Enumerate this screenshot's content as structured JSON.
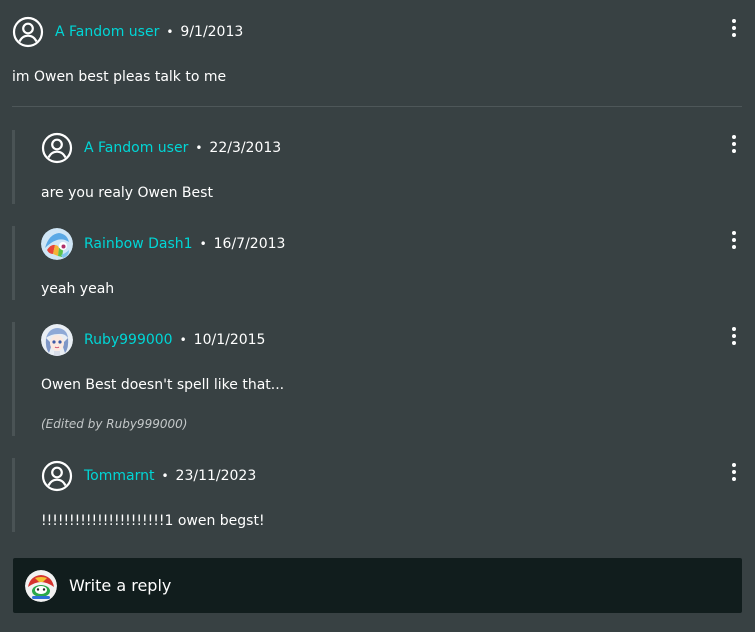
{
  "thread": {
    "root": {
      "user": "A Fandom user",
      "date": "9/1/2013",
      "text": "im Owen best pleas talk to me",
      "avatar_icon": "default-user-icon"
    },
    "replies": [
      {
        "user": "A Fandom user",
        "date": "22/3/2013",
        "text": "are you realy Owen Best",
        "avatar_icon": "default-user-icon"
      },
      {
        "user": "Rainbow Dash1",
        "date": "16/7/2013",
        "text": "yeah yeah",
        "avatar_icon": "rainbow-dash-avatar"
      },
      {
        "user": "Ruby999000",
        "date": "10/1/2015",
        "text": "Owen Best doesn't spell like that...",
        "edited_note": "(Edited by Ruby999000)",
        "avatar_icon": "ruby-avatar"
      },
      {
        "user": "Tommarnt",
        "date": "23/11/2023",
        "text": "!!!!!!!!!!!!!!!!!!!!!!1 owen begst!",
        "avatar_icon": "default-user-icon"
      }
    ]
  },
  "separator": "•",
  "reply_box": {
    "placeholder": "Write a reply",
    "avatar_icon": "current-user-avatar"
  },
  "colors": {
    "background": "#384143",
    "username": "#00d6d6",
    "reply_box": "#111d1d",
    "rail": "#4a5355"
  }
}
